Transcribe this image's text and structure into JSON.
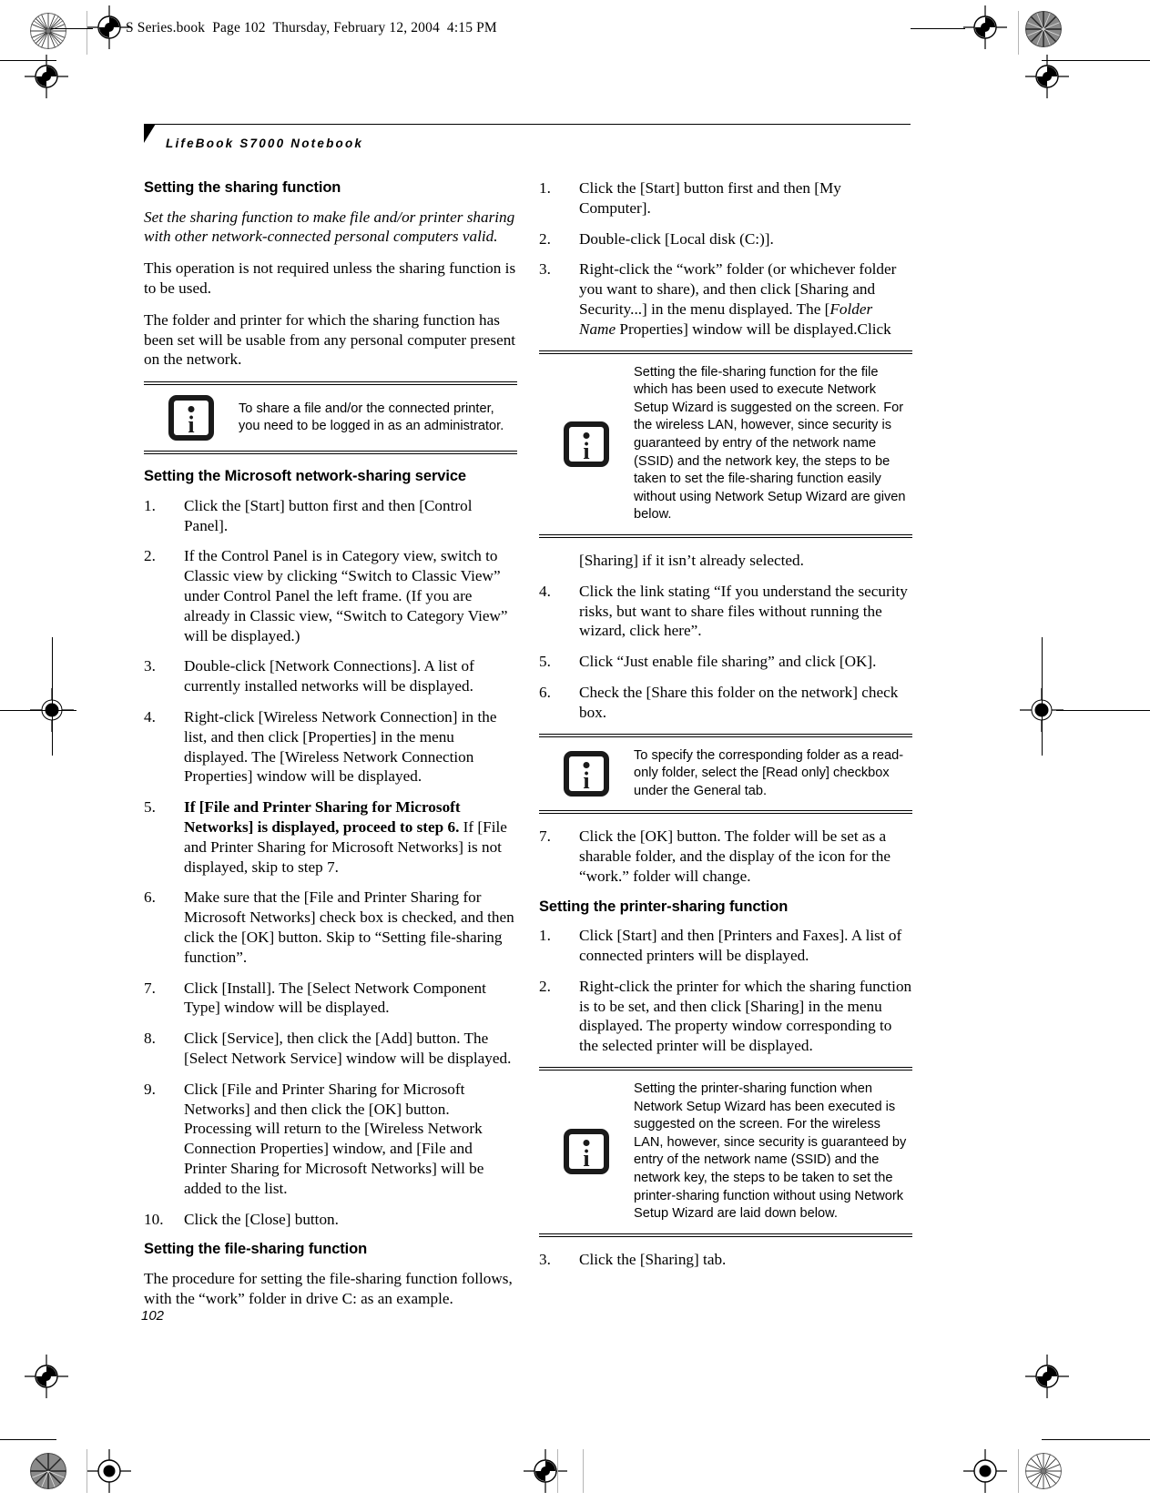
{
  "print_marks": {
    "file_header": "S Series.book  Page 102  Thursday, February 12, 2004  4:15 PM"
  },
  "running_head": "LifeBook S7000 Notebook",
  "page_number": "102",
  "left_column": {
    "heading_1": "Setting the sharing function",
    "intro_italic": "Set the sharing function to make file and/or printer sharing with other network-connected personal computers valid.",
    "para_1": "This operation is not required unless the sharing function is to be used.",
    "para_2": "The folder and printer for which the sharing function has been set will be usable from any personal computer present on the network.",
    "note_1": "To share a file and/or the connected printer, you need to be logged in as an administrator.",
    "heading_2": "Setting the Microsoft network-sharing service",
    "steps": [
      {
        "num": "1.",
        "text": "Click the [Start] button first and then [Control Panel]."
      },
      {
        "num": "2.",
        "text": "If the Control Panel is in Category view, switch to Classic view by clicking “Switch to Classic View” under Control Panel the left frame. (If you are already in Classic view, “Switch to Category View” will be displayed.)"
      },
      {
        "num": "3.",
        "text": "Double-click [Network Connections]. A list of currently installed networks will be displayed."
      },
      {
        "num": "4.",
        "text": "Right-click [Wireless Network Connection] in the list, and then click [Properties] in the menu displayed. The [Wireless Network Connection Properties] window will be displayed."
      },
      {
        "num": "5.",
        "bold_lead": "If [File and Printer Sharing for Microsoft Networks] is displayed, proceed to step 6.",
        "text": " If [File and Printer Sharing for Microsoft Networks] is not displayed, skip to step 7."
      },
      {
        "num": "6.",
        "text": "Make sure that the [File and Printer Sharing for Microsoft Networks] check box is checked, and then click the [OK] button. Skip to “Setting file-sharing function”."
      },
      {
        "num": "7.",
        "text": "Click [Install]. The [Select Network Component Type] window will be displayed."
      },
      {
        "num": "8.",
        "text": "Click [Service], then click the [Add] button. The [Select Network Service] window will be displayed."
      },
      {
        "num": "9.",
        "text": "Click [File and Printer Sharing for Microsoft Networks] and then click the [OK] button. Processing will return to the [Wireless Network Connection Properties] window, and [File and Printer Sharing for Microsoft Networks] will be added to the list."
      },
      {
        "num": "10.",
        "text": "Click the [Close] button."
      }
    ],
    "heading_3": "Setting the file-sharing function",
    "para_3": "The procedure for setting the file-sharing function follows, with the “work” folder in drive C: as an example."
  },
  "right_column": {
    "steps_a": [
      {
        "num": "1.",
        "text": "Click the [Start] button first and then [My Computer]."
      },
      {
        "num": "2.",
        "text": "Double-click [Local disk (C:)]."
      },
      {
        "num": "3.",
        "text": "Right-click the “work” folder (or whichever folder you want to share), and then click [Sharing and Security...] in the menu displayed. The [",
        "italic_part": "Folder Name",
        "text_tail": " Properties] window will be displayed.Click"
      }
    ],
    "note_1": "Setting the file-sharing function for the file which has been used to execute Network Setup Wizard is suggested on the screen. For the wireless LAN, however, since security is guaranteed by entry of the network name (SSID) and the network key, the steps to be taken to set the file-sharing function easily without using Network Setup Wizard are given below.",
    "continuation": "[Sharing] if it isn’t already selected.",
    "steps_b": [
      {
        "num": "4.",
        "text": "Click the link stating “If you understand the security risks, but want to share files without running the wizard, click here”."
      },
      {
        "num": "5.",
        "text": "Click “Just enable file sharing” and click [OK]."
      },
      {
        "num": "6.",
        "text": "Check the [Share this folder on the network] check box."
      }
    ],
    "note_2": "To specify the corresponding folder as a read-only folder, select the [Read only] checkbox under the General tab.",
    "steps_c": [
      {
        "num": "7.",
        "text": "Click the [OK] button. The folder will be set as a sharable folder, and the display of the icon for the “work.” folder will change."
      }
    ],
    "heading_1": "Setting the printer-sharing function",
    "steps_d": [
      {
        "num": "1.",
        "text": "Click [Start] and then [Printers and Faxes]. A list of connected printers will be displayed."
      },
      {
        "num": "2.",
        "text": "Right-click the printer for which the sharing function is to be set, and then click [Sharing] in the menu displayed. The property window corresponding to the selected printer will be displayed."
      }
    ],
    "note_3": "Setting the printer-sharing function when Network Setup Wizard has been executed is suggested on the screen. For the wireless LAN, however, since security is guaranteed by entry of the network name (SSID) and the network key, the steps to be taken to set the printer-sharing function without using Network Setup Wizard are laid down below.",
    "steps_e": [
      {
        "num": "3.",
        "text": "Click the [Sharing] tab."
      }
    ]
  },
  "icons": {
    "info": "info-icon",
    "registration": "registration-target-icon",
    "rosette": "color-rosette-icon"
  }
}
